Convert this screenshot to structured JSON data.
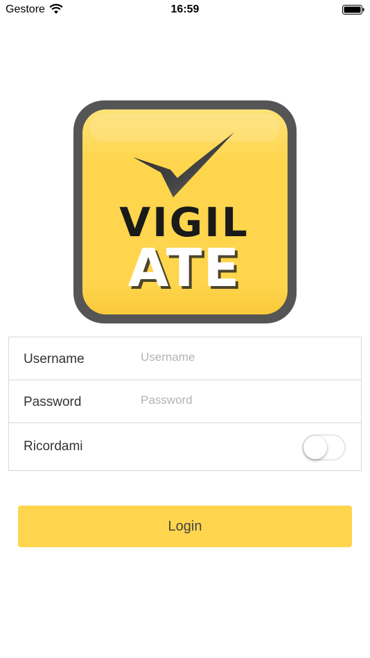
{
  "status_bar": {
    "carrier": "Gestore",
    "time": "16:59",
    "wifi_icon": "wifi-icon",
    "battery_icon": "battery-icon"
  },
  "logo": {
    "line1": "VIGIL",
    "line2": "ATE",
    "icon": "checkmark-icon",
    "colors": {
      "frame": "#555555",
      "face": "#fed54c",
      "text_dark": "#1a1a1a",
      "text_light": "#ffffff"
    }
  },
  "form": {
    "username": {
      "label": "Username",
      "placeholder": "Username",
      "value": ""
    },
    "password": {
      "label": "Password",
      "placeholder": "Password",
      "value": ""
    },
    "remember": {
      "label": "Ricordami",
      "checked": false
    }
  },
  "login_button": {
    "label": "Login",
    "color": "#fed54c"
  }
}
